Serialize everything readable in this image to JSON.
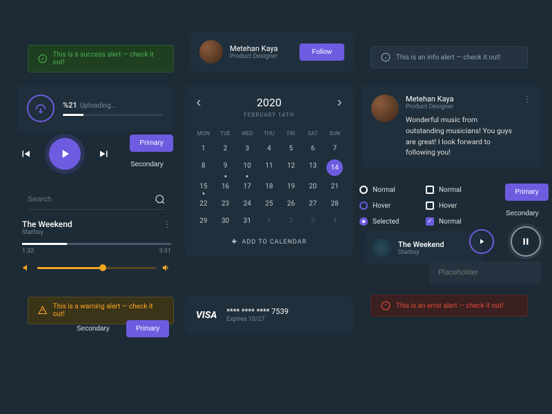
{
  "alerts": {
    "success": "This is a success alert — check it out!",
    "info": "This is an info alert — check it out!",
    "warning": "This is a warning alert — check it out!",
    "error": "This is an error alert — check it out!"
  },
  "profile": {
    "name": "Metehan Kaya",
    "role": "Product Designer",
    "follow": "Follow"
  },
  "upload": {
    "percent": "%21",
    "label": "Uploading..."
  },
  "buttons": {
    "primary": "Primary",
    "secondary": "Secondary"
  },
  "search": {
    "placeholder": "Search"
  },
  "nowplaying": {
    "track": "The Weekend",
    "artist": "Starboy",
    "current": "1:32",
    "total": "3:31"
  },
  "calendar": {
    "year": "2020",
    "month": "FEBRUARY 14TH",
    "dow": [
      "MON",
      "TUE",
      "WED",
      "THU",
      "FRI",
      "SAT",
      "SUN"
    ],
    "days": [
      {
        "n": "1"
      },
      {
        "n": "2"
      },
      {
        "n": "3"
      },
      {
        "n": "4"
      },
      {
        "n": "5"
      },
      {
        "n": "6"
      },
      {
        "n": "7"
      },
      {
        "n": "8"
      },
      {
        "n": "9",
        "dot": true
      },
      {
        "n": "10",
        "dot": true
      },
      {
        "n": "11"
      },
      {
        "n": "12"
      },
      {
        "n": "13"
      },
      {
        "n": "14",
        "sel": true
      },
      {
        "n": "15",
        "dot": true
      },
      {
        "n": "16"
      },
      {
        "n": "17"
      },
      {
        "n": "18"
      },
      {
        "n": "19"
      },
      {
        "n": "20"
      },
      {
        "n": "21"
      },
      {
        "n": "22"
      },
      {
        "n": "23"
      },
      {
        "n": "24"
      },
      {
        "n": "25"
      },
      {
        "n": "26"
      },
      {
        "n": "27"
      },
      {
        "n": "28"
      },
      {
        "n": "29"
      },
      {
        "n": "30"
      },
      {
        "n": "31"
      },
      {
        "n": "1",
        "dim": true
      },
      {
        "n": "2",
        "dim": true
      },
      {
        "n": "3",
        "dim": true
      },
      {
        "n": "4",
        "dim": true
      }
    ],
    "add": "ADD TO CALENDAR"
  },
  "visa": {
    "brand": "VISA",
    "number": "**** **** **** 7539",
    "expires": "Expires 10/27"
  },
  "comment": {
    "name": "Metehan Kaya",
    "role": "Product Designer",
    "text": "Wonderful music from outstanding musicians! You guys are great!  I look forward to following you!"
  },
  "radios": [
    "Normal",
    "Hover",
    "Selected"
  ],
  "checks": [
    "Normal",
    "Hover",
    "Normal"
  ],
  "mini": {
    "track": "The Weekend",
    "artist": "Starboy"
  },
  "placeholder": {
    "text": "Placeholder"
  }
}
